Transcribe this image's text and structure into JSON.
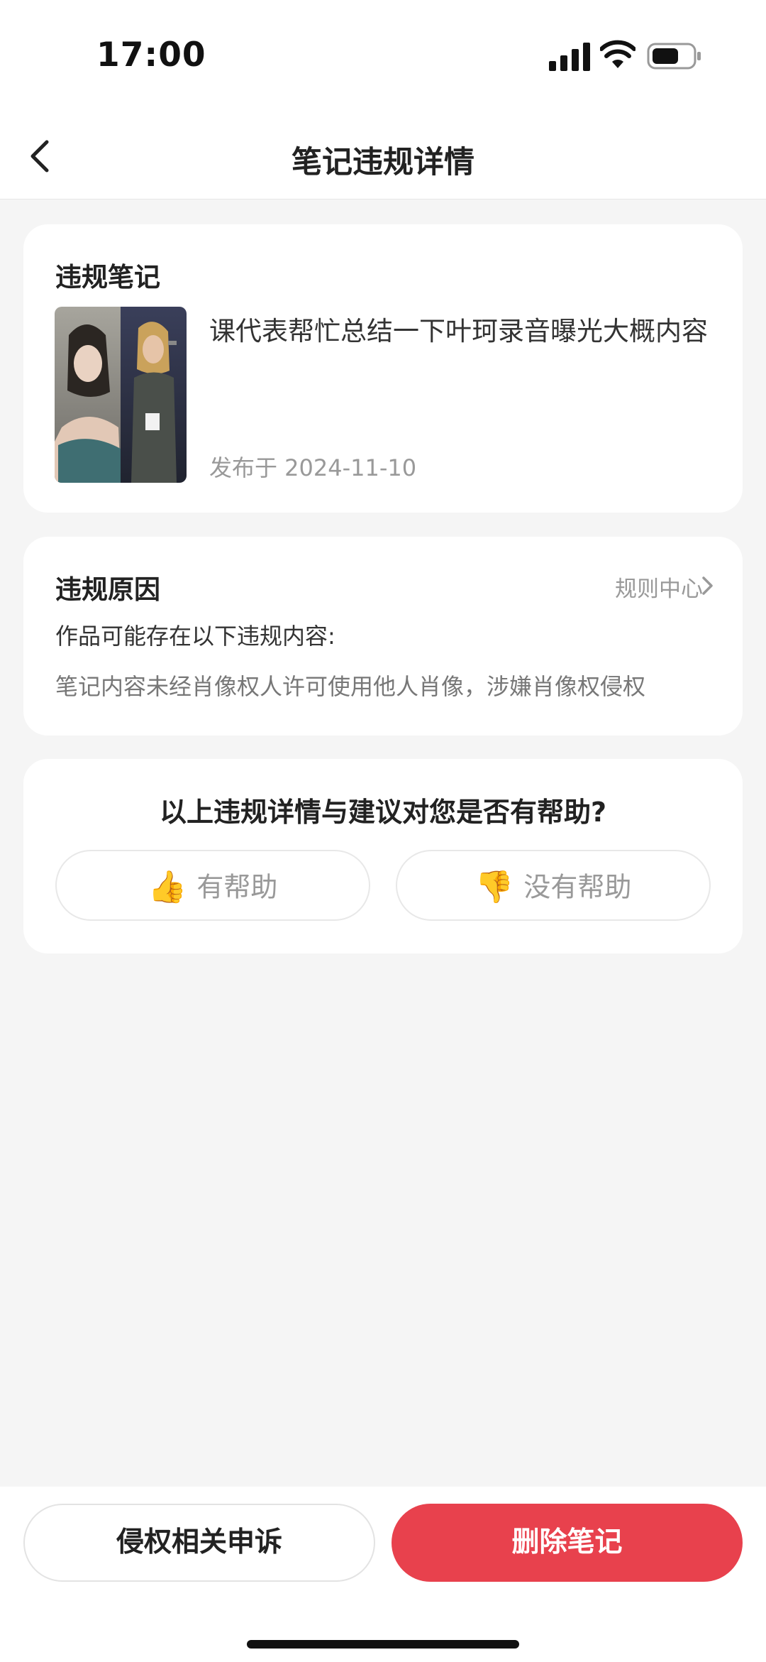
{
  "status_bar": {
    "time": "17:00"
  },
  "nav": {
    "title": "笔记违规详情"
  },
  "note_card": {
    "heading": "违规笔记",
    "note_title": "课代表帮忙总结一下叶珂录音曝光大概内容",
    "publish_date": "发布于 2024-11-10"
  },
  "reason_card": {
    "heading": "违规原因",
    "rule_center_label": "规则中心",
    "intro": "作品可能存在以下违规内容:",
    "reason": "笔记内容未经肖像权人许可使用他人肖像，涉嫌肖像权侵权"
  },
  "feedback": {
    "question": "以上违规详情与建议对您是否有帮助?",
    "helpful_label": "有帮助",
    "not_helpful_label": "没有帮助",
    "helpful_icon": "👍",
    "not_helpful_icon": "👎"
  },
  "actions": {
    "appeal_label": "侵权相关申诉",
    "delete_label": "删除笔记"
  },
  "colors": {
    "accent": "#e8414d",
    "background": "#f5f5f5"
  }
}
